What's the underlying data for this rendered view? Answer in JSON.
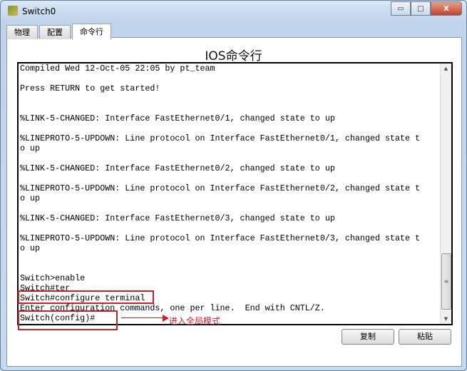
{
  "window": {
    "title": "Switch0",
    "controls": {
      "minimize": "▭",
      "maximize": "□",
      "close": "X"
    }
  },
  "tabs": [
    {
      "label": "物理"
    },
    {
      "label": "配置"
    },
    {
      "label": "命令行",
      "active": true
    }
  ],
  "heading": "IOS命令行",
  "terminal": {
    "lines": [
      "Compiled Wed 12-Oct-05 22:05 by pt_team",
      "",
      "Press RETURN to get started!",
      "",
      "",
      "%LINK-5-CHANGED: Interface FastEthernet0/1, changed state to up",
      "",
      "%LINEPROTO-5-UPDOWN: Line protocol on Interface FastEthernet0/1, changed state t",
      "o up",
      "",
      "%LINK-5-CHANGED: Interface FastEthernet0/2, changed state to up",
      "",
      "%LINEPROTO-5-UPDOWN: Line protocol on Interface FastEthernet0/2, changed state t",
      "o up",
      "",
      "%LINK-5-CHANGED: Interface FastEthernet0/3, changed state to up",
      "",
      "%LINEPROTO-5-UPDOWN: Line protocol on Interface FastEthernet0/3, changed state t",
      "o up",
      "",
      "",
      "Switch>enable",
      "Switch#ter",
      "Switch#configure terminal",
      "Enter configuration commands, one per line.  End with CNTL/Z.",
      "Switch(config)#"
    ]
  },
  "annotation": {
    "text": "进入全局模式",
    "color": "#c8232c"
  },
  "buttons": {
    "copy": "复制",
    "paste": "粘贴"
  }
}
